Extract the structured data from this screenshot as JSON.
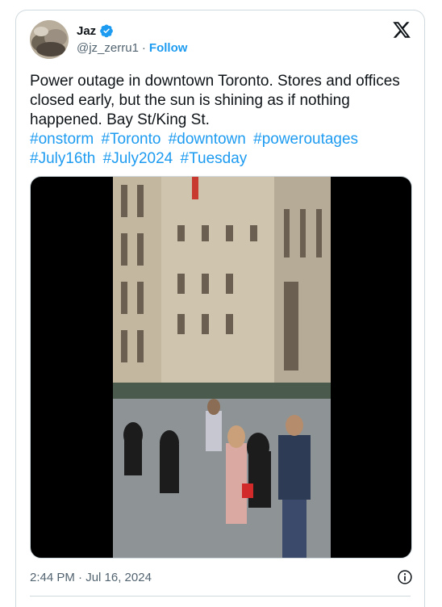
{
  "author": {
    "name": "Jaz",
    "handle": "@jz_zerru1",
    "separator": "·",
    "follow_label": "Follow"
  },
  "tweet": {
    "text": "Power outage in downtown Toronto. Stores and offices closed early, but the sun is shining as if nothing happened. Bay St/King St.",
    "hashtags": [
      "#onstorm",
      "#Toronto",
      "#downtown",
      "#poweroutages",
      "#July16th",
      "#July2024",
      "#Tuesday"
    ]
  },
  "footer": {
    "timestamp": "2:44 PM · Jul 16, 2024"
  },
  "icons": {
    "verified": "verified-badge-icon",
    "x_logo": "x-logo-icon",
    "info": "info-icon"
  },
  "colors": {
    "accent": "#1d9bf0",
    "text": "#0f1419",
    "secondary": "#536471",
    "border": "#cfd9de"
  }
}
